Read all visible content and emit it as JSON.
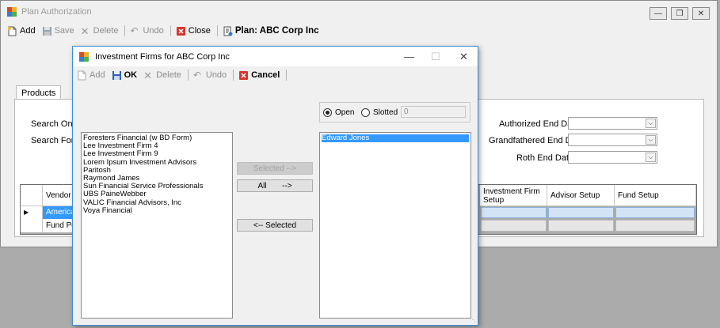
{
  "main_window": {
    "title": "Plan Authorization",
    "toolbar": {
      "add": "Add",
      "save": "Save",
      "delete": "Delete",
      "undo": "Undo",
      "close": "Close",
      "plan_label": "Plan: ABC Corp Inc"
    },
    "tabs": [
      "Products"
    ],
    "search_on_label": "Search On:",
    "search_for_label": "Search For:",
    "authorized_end_date_label": "Authorized End Date:",
    "grandfathered_end_date_label": "Grandfathered End Date:",
    "roth_end_date_label": "Roth End Date:",
    "grid": {
      "columns": [
        "Vendor",
        "Investment Firm Setup",
        "Advisor Setup",
        "Fund Setup"
      ],
      "rows": [
        {
          "vendor": "American"
        },
        {
          "vendor": "Fund Por"
        }
      ]
    }
  },
  "dialog": {
    "title": "Investment Firms for ABC Corp Inc",
    "toolbar": {
      "add": "Add",
      "ok": "OK",
      "delete": "Delete",
      "undo": "Undo",
      "cancel": "Cancel"
    },
    "available_firms": [
      "Foresters Financial (w BD Form)",
      "Lee Investment Firm 4",
      "Lee Investment Firm 9",
      "Lorem Ipsum Investment Advisors",
      "Paritosh",
      "Raymond James",
      "Sun Financial Service Professionals",
      "UBS PaineWebber",
      "VALIC Financial Advisors, Inc",
      "Voya Financial"
    ],
    "buttons": {
      "selected_right": "Selected -->",
      "all_right": "All       -->",
      "selected_left": "<-- Selected"
    },
    "radio_open": "Open",
    "radio_slotted": "Slotted",
    "slotted_value": "0",
    "selected_firms": [
      "Edward Jones"
    ]
  },
  "colors": {
    "selection": "#3399ff",
    "dialog_border": "#3b8fd9",
    "window_bg": "#f0f0f0",
    "backdrop": "#ababab"
  }
}
